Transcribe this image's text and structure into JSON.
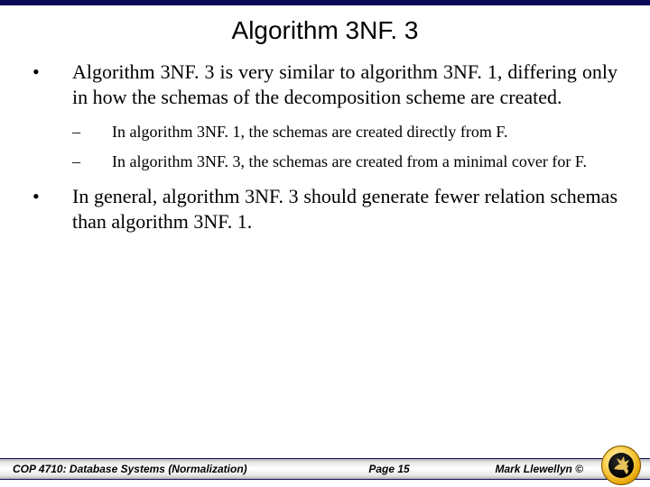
{
  "title": "Algorithm 3NF. 3",
  "bullets": [
    {
      "text": "Algorithm 3NF. 3 is very similar to algorithm 3NF. 1, differing only in how the schemas of the decomposition scheme are created.",
      "sub": [
        "In algorithm 3NF. 1, the schemas are created directly from F.",
        "In algorithm 3NF. 3, the schemas are created from a minimal cover for F."
      ]
    },
    {
      "text": "In general, algorithm 3NF. 3 should generate fewer relation schemas than algorithm 3NF. 1.",
      "sub": []
    }
  ],
  "footer": {
    "left": "COP 4710: Database Systems  (Normalization)",
    "center": "Page 15",
    "right": "Mark Llewellyn ©"
  },
  "marks": {
    "bullet": "•",
    "dash": "–"
  }
}
